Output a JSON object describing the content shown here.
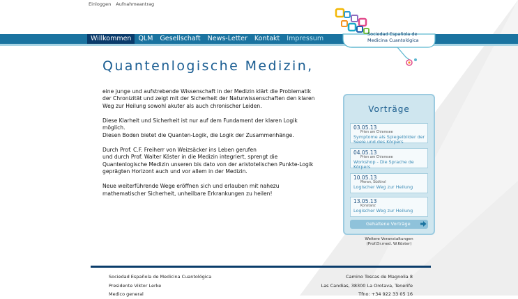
{
  "top_links": [
    "Einloggen",
    "Aufnahmeantrag"
  ],
  "nav": {
    "items": [
      {
        "label": "Willkommen"
      },
      {
        "label": "QLM"
      },
      {
        "label": "Gesellschaft"
      },
      {
        "label": "News-Letter"
      },
      {
        "label": "Kontakt"
      },
      {
        "label": "Impressum"
      }
    ]
  },
  "logo": {
    "line1": "Sociedad Española de",
    "line2": "Medicina Cuantológica"
  },
  "main": {
    "title": "Quantenlogische Medizin,",
    "paragraphs": [
      "eine junge und aufstrebende Wissenschaft in der Medizin klärt die Problematik\nder Chronizität und zeigt mit der Sicherheit der Naturwissenschaften den klaren\nWeg zur Heilung sowohl akuter als auch chronischer Leiden.",
      "Diese Klarheit und Sicherheit ist nur auf dem Fundament der klaren Logik\nmöglich.\nDiesen Boden bietet die Quanten-Logik, die Logik der Zusammenhänge.",
      "Durch Prof. C.F. Freiherr von Weizsäcker ins Leben gerufen\nund durch Prof. Walter Köster in die Medizin integriert, sprengt die\nQuantenlogische Medizin unseren bis dato von der aristotelischen Punkte-Logik\ngeprägten Horizont auch und vor allem in der Medizin.",
      "Neue weiterführende Wege eröffnen sich und erlauben mit nahezu\nmathematischer Sicherheit, unheilbare Erkrankungen zu heilen!"
    ]
  },
  "sidebar": {
    "title": "Vorträge",
    "events": [
      {
        "date": "03.05.13",
        "location": "Prien am Chiemsee",
        "title": "Symptome als Spiegelbilder der Seele und des Körpers"
      },
      {
        "date": "04.05.13",
        "location": "Prien am Chiemsee",
        "title": "Workshop - Die Sprache de Körpers"
      },
      {
        "date": "10.05.13",
        "location": "Meran, Südtirol",
        "title": "Logischer Weg zur Heilung"
      },
      {
        "date": "13.05.13",
        "location": "Konstanz",
        "title": "Logischer Weg zur Heilung"
      }
    ],
    "past_button": "Gehaltene Vorträge",
    "more_line1": "Weitere Veranstaltungen",
    "more_line2": "(Prof.Dr.med. W.Köster)"
  },
  "footer": {
    "left": [
      "Sociedad Española de Medicina Cuantológica",
      "Presidente Viktor Lerke",
      "Medico general"
    ],
    "right": [
      "Camino Toscas de Magnolia 8",
      "Las Candias, 38300 La Orotava, Tenerife",
      "Tfno: +34 922 33 05 16"
    ]
  },
  "colors": {
    "nav_bar": "#1a73a0",
    "nav_active": "#0a3b6b",
    "accent": "#1a5d92",
    "panel_bg": "#cfe6ef",
    "footer_rule": "#0b3d6b"
  },
  "icons": [
    "logo-squares-icon",
    "arrow-right-icon"
  ]
}
